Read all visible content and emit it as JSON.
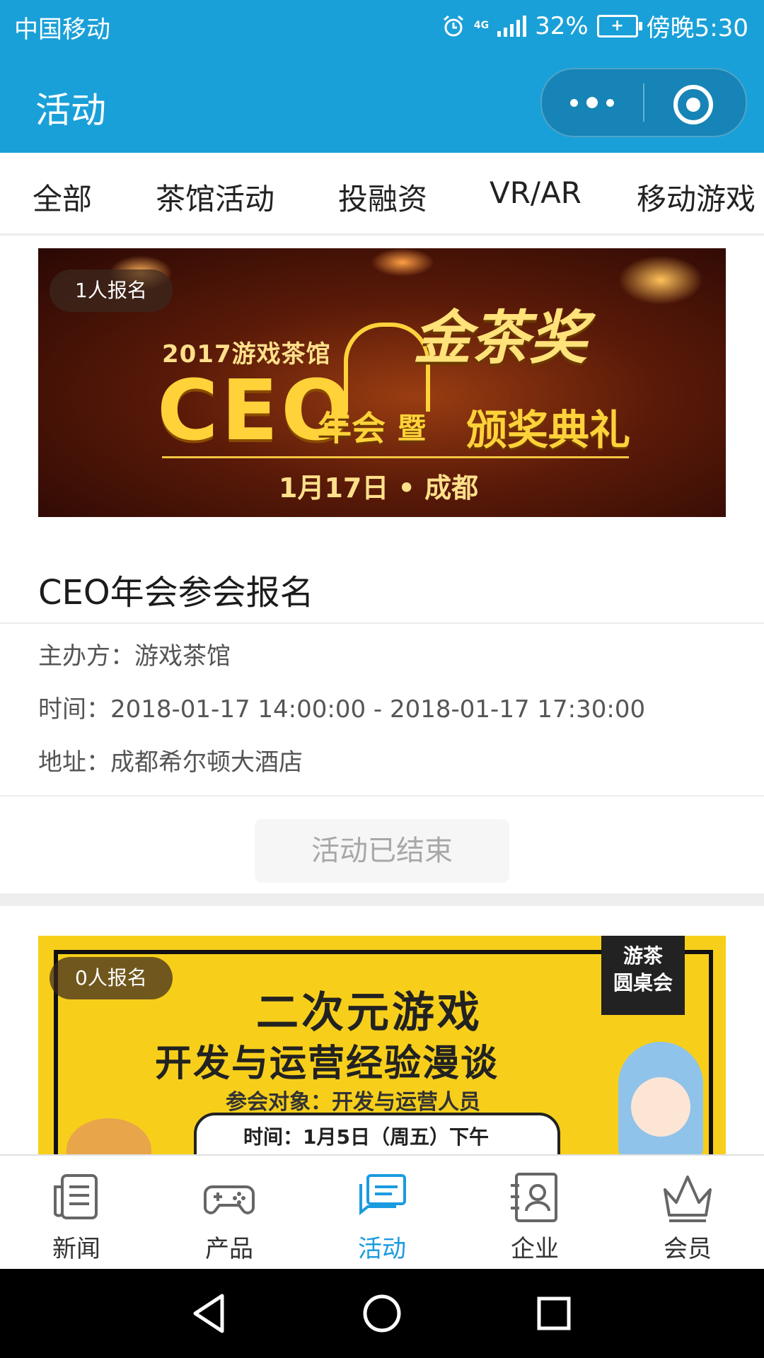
{
  "status_bar": {
    "carrier": "中国移动",
    "network": "4G",
    "battery_percent": "32%",
    "time": "傍晚5:30"
  },
  "header": {
    "title": "活动",
    "more_icon": "more-dots-icon",
    "close_icon": "target-circle-icon"
  },
  "tabs": [
    "全部",
    "茶馆活动",
    "投融资",
    "VR/AR",
    "移动游戏"
  ],
  "events": [
    {
      "signups": "1人报名",
      "banner": {
        "year_title": "2017游戏茶馆",
        "ceo": "CEO",
        "annual": "年会",
        "ji": "暨",
        "gold": "金茶奖",
        "award": "颁奖典礼",
        "date_place": "1月17日 • 成都"
      },
      "title": "CEO年会参会报名",
      "organizer_label": "主办方：",
      "organizer": "游戏茶馆",
      "time_label": "时间：",
      "time": "2018-01-17 14:00:00 - 2018-01-17 17:30:00",
      "address_label": "地址：",
      "address": "成都希尔顿大酒店",
      "status_button": "活动已结束"
    },
    {
      "signups": "0人报名",
      "banner": {
        "tag_line1": "游茶",
        "tag_line2": "圆桌会",
        "line1": "二次元游戏",
        "line2": "开发与运营经验漫谈",
        "line3": "参会对象：开发与运营人员",
        "line4": "时间：1月5日（周五）下午"
      }
    }
  ],
  "bottom_nav": [
    {
      "label": "新闻",
      "icon": "news-icon"
    },
    {
      "label": "产品",
      "icon": "gamepad-icon"
    },
    {
      "label": "活动",
      "icon": "chat-icon",
      "active": true
    },
    {
      "label": "企业",
      "icon": "contact-card-icon"
    },
    {
      "label": "会员",
      "icon": "crown-icon"
    }
  ],
  "colors": {
    "brand": "#1aa0d8",
    "active_nav": "#1a9be0"
  }
}
